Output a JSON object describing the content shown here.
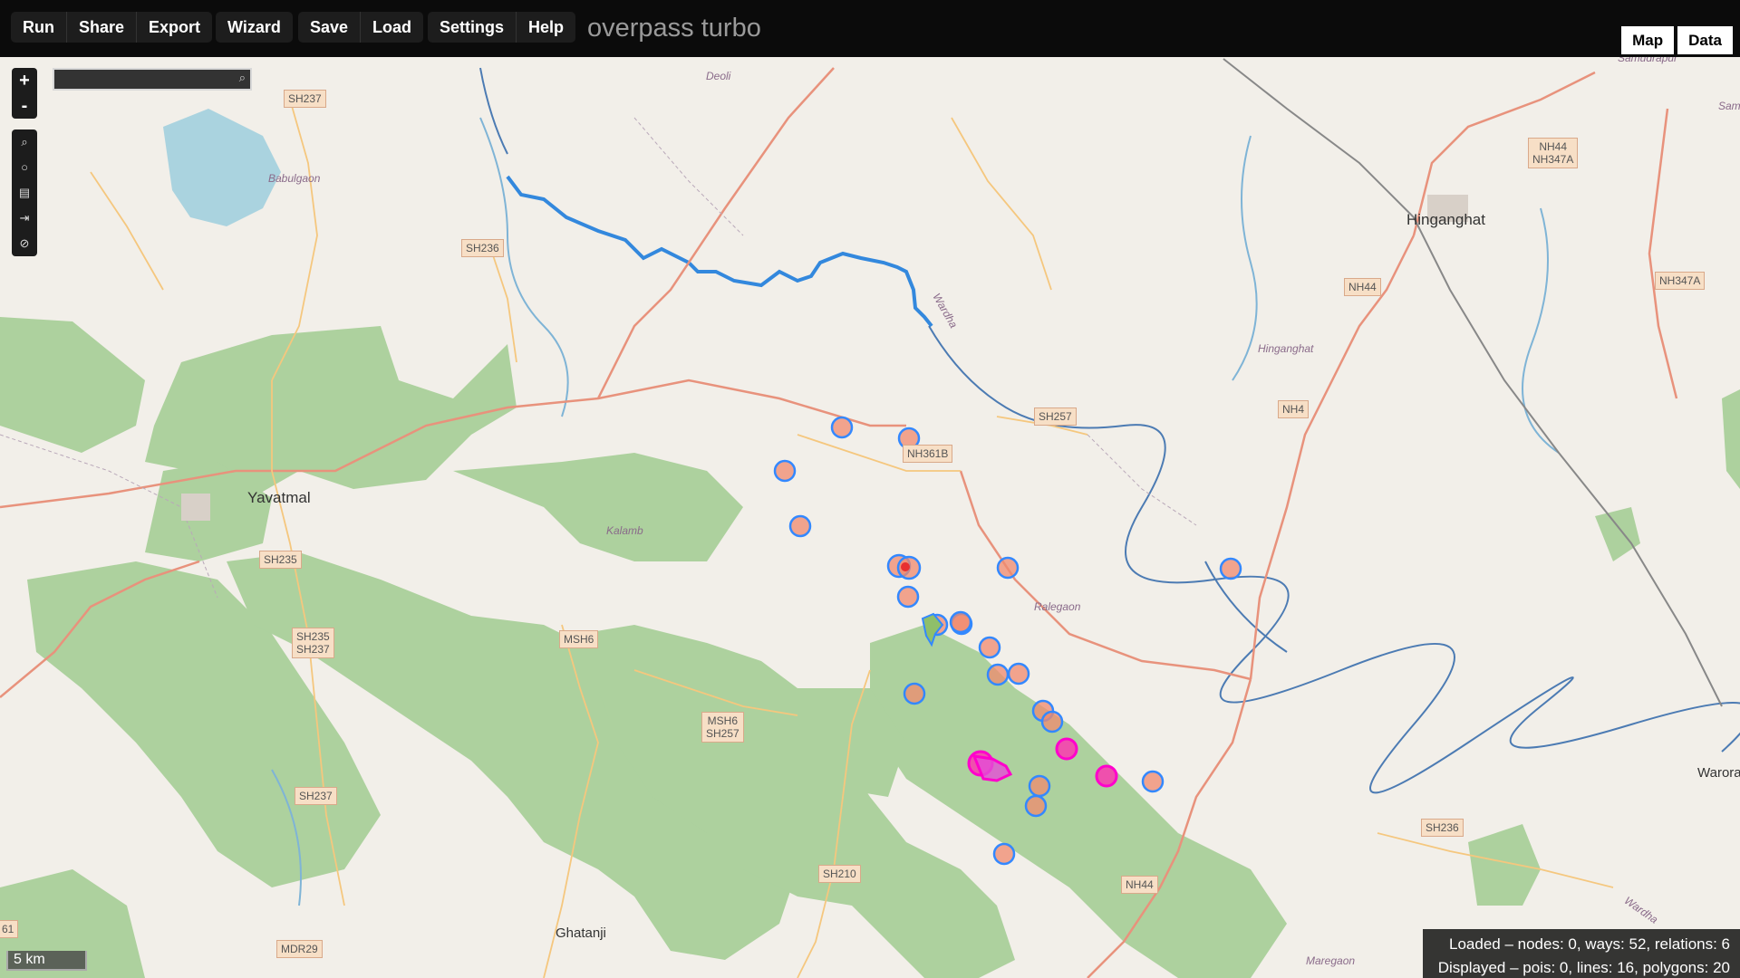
{
  "toolbar": {
    "run": "Run",
    "share": "Share",
    "export": "Export",
    "wizard": "Wizard",
    "save": "Save",
    "load": "Load",
    "settings": "Settings",
    "help": "Help",
    "brand": "overpass turbo",
    "map_tab": "Map",
    "data_tab": "Data"
  },
  "map_controls": {
    "zoom_in": "+",
    "zoom_out": "-",
    "search_placeholder": ""
  },
  "status": {
    "loaded": "Loaded – nodes: 0, ways: 52, relations: 6",
    "displayed": "Displayed – pois: 0, lines: 16, polygons: 20"
  },
  "scale_label": "5 km",
  "places": {
    "deoli": "Deoli",
    "babulgaon": "Babulgaon",
    "wardha_river": "Wardha",
    "hinganghat_area": "Hinganghat",
    "kalamb": "Kalamb",
    "ralegaon": "Ralegaon",
    "maregaon": "Maregaon",
    "samudrapur": "Samudrapur",
    "sam": "Sam",
    "wardha_lower": "Wardha"
  },
  "towns": {
    "hinganghat": "Hinganghat",
    "yavatmal": "Yavatmal",
    "ghatanji": "Ghatanji",
    "warora": "Warora"
  },
  "roads": {
    "sh237a": "SH237",
    "sh236a": "SH236",
    "sh257": "SH257",
    "nh361b": "NH361B",
    "sh235": "SH235",
    "sh235_237a": "SH235",
    "sh235_237b": "SH237",
    "msh6": "MSH6",
    "msh6_257a": "MSH6",
    "msh6_257b": "SH257",
    "sh237b": "SH237",
    "sh210": "SH210",
    "mdr29": "MDR29",
    "nh44a": "NH44",
    "nh44b": "NH44",
    "nh44_347a": "NH44",
    "nh44_347b": "NH347A",
    "nh347a": "NH347A",
    "nh4": "NH4",
    "sh236b": "SH236",
    "edge61": "61"
  },
  "colors": {
    "toolbar_bg": "#0b0b0b",
    "map_bg": "#f2efe9",
    "forest": "#add19e",
    "water": "#aad3df",
    "river": "#3388dd",
    "road_primary": "#e8927c",
    "road_secondary": "#f5c77e",
    "poi_fill": "#f08a6e",
    "poi_stroke": "#3388ff",
    "highlight": "#ff00cc"
  },
  "icons": {
    "search": "magnifier-icon",
    "circle": "circle-icon",
    "layers": "layers-icon",
    "fit": "fit-icon",
    "stop": "stop-icon"
  }
}
